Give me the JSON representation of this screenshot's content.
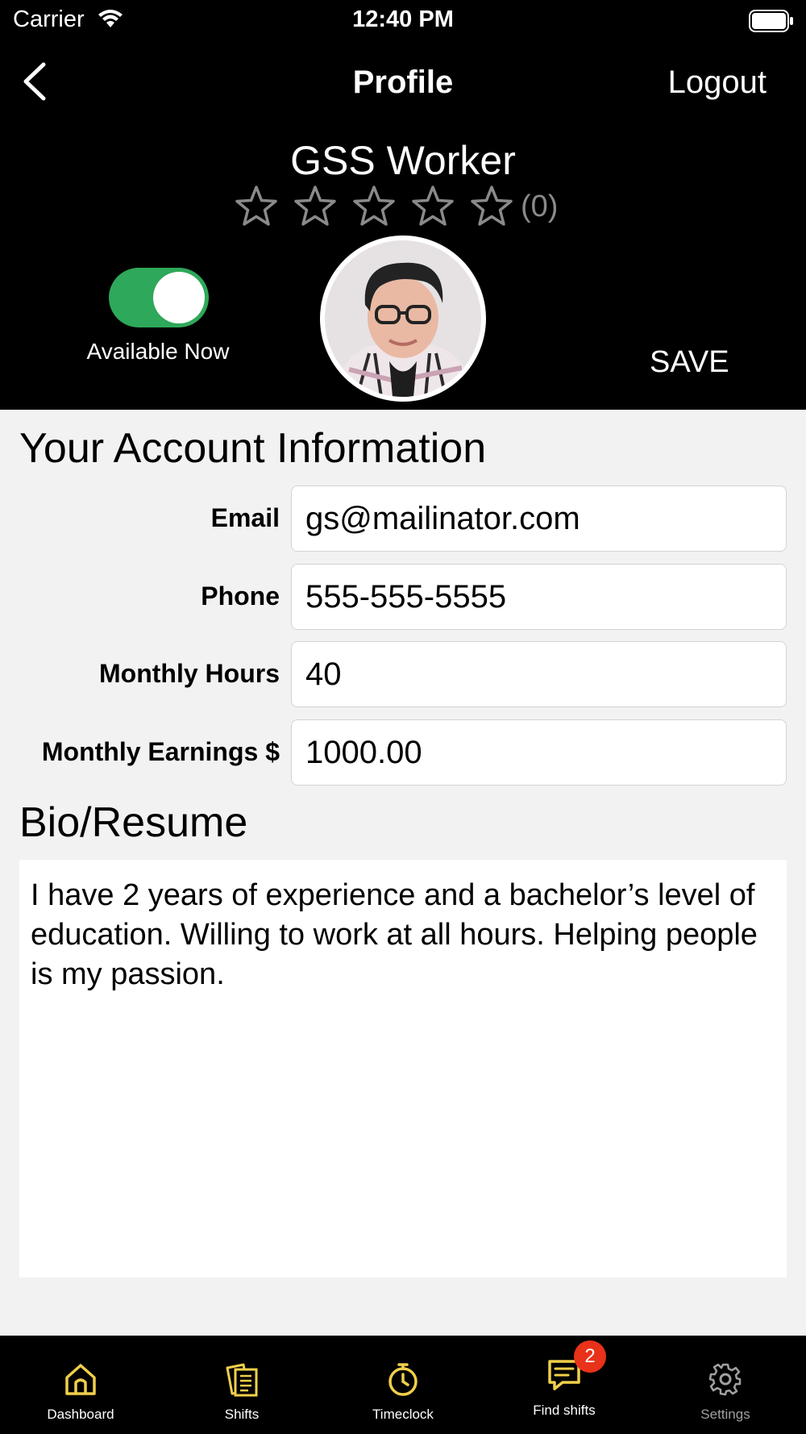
{
  "status_bar": {
    "carrier": "Carrier",
    "time": "12:40 PM"
  },
  "nav": {
    "title": "Profile",
    "logout_label": "Logout"
  },
  "profile": {
    "name": "GSS Worker",
    "rating_count": "(0)",
    "rating_stars_filled": 0,
    "rating_stars_total": 5,
    "availability_label": "Available Now",
    "available": true,
    "save_label": "SAVE"
  },
  "account": {
    "title": "Your Account Information",
    "fields": [
      {
        "label": "Email",
        "value": "gs@mailinator.com"
      },
      {
        "label": "Phone",
        "value": "555-555-5555"
      },
      {
        "label": "Monthly Hours",
        "value": "40"
      },
      {
        "label": "Monthly Earnings $",
        "value": "1000.00"
      }
    ]
  },
  "bio": {
    "title": "Bio/Resume",
    "text": "I have 2 years of experience and a bachelor’s level of education. Willing to work at all hours. Helping people is my passion."
  },
  "tabs": [
    {
      "label": "Dashboard",
      "icon": "home-icon"
    },
    {
      "label": "Shifts",
      "icon": "documents-icon"
    },
    {
      "label": "Timeclock",
      "icon": "stopwatch-icon"
    },
    {
      "label": "Find shifts",
      "icon": "chat-icon",
      "badge": "2"
    },
    {
      "label": "Settings",
      "icon": "gear-icon"
    }
  ],
  "colors": {
    "header_bg": "#000000",
    "toggle_on": "#2ea85a",
    "tab_icon_active": "#f0cf4a",
    "badge": "#e8321a",
    "page_bg": "#f2f2f2"
  }
}
